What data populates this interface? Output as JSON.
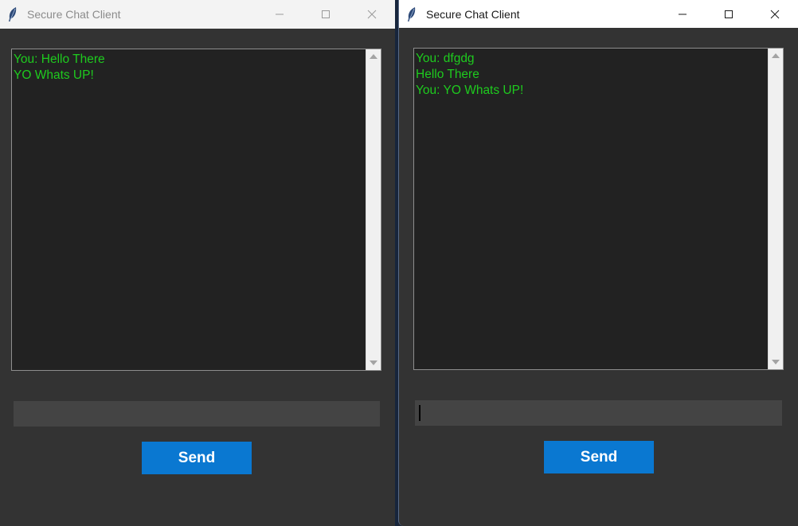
{
  "windows": [
    {
      "title": "Secure Chat Client",
      "messages": [
        "You: Hello There",
        "YO Whats UP!"
      ],
      "input_value": "",
      "send_label": "Send",
      "focused": false
    },
    {
      "title": "Secure Chat Client",
      "messages": [
        "You: dfgdg",
        "Hello There",
        "You: YO Whats UP!"
      ],
      "input_value": "",
      "send_label": "Send",
      "focused": true
    }
  ],
  "colors": {
    "window_bg": "#333333",
    "chat_bg": "#222222",
    "chat_text": "#1ecb1e",
    "input_bg": "#444444",
    "send_button": "#0a78d1"
  },
  "icons": {
    "app": "feather-icon",
    "minimize": "minimize-icon",
    "maximize": "maximize-icon",
    "close": "close-icon"
  }
}
